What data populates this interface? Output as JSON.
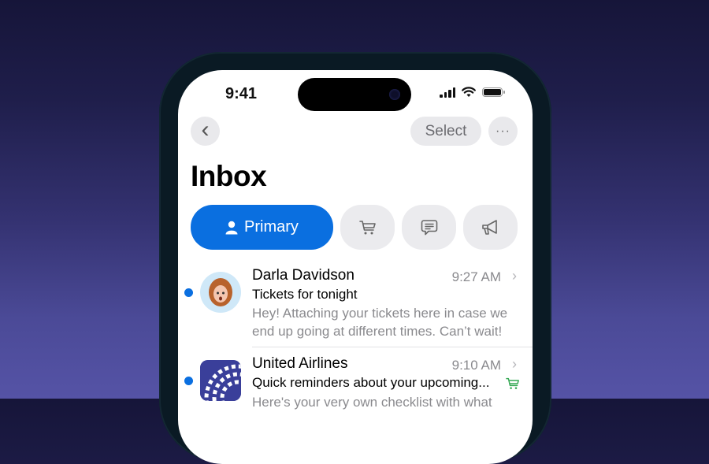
{
  "status_bar": {
    "time": "9:41",
    "icons": [
      "signal-icon",
      "wifi-icon",
      "battery-icon"
    ]
  },
  "nav": {
    "back_icon": "chevron-left-icon",
    "select_label": "Select",
    "more_icon": "ellipsis-icon",
    "more_glyph": "···",
    "back_glyph": "‹"
  },
  "header": {
    "title": "Inbox"
  },
  "categories": [
    {
      "label": "Primary",
      "icon": "person-icon",
      "active": true
    },
    {
      "label": "",
      "icon": "cart-icon",
      "active": false
    },
    {
      "label": "",
      "icon": "chat-icon",
      "active": false
    },
    {
      "label": "",
      "icon": "megaphone-icon",
      "active": false
    }
  ],
  "messages": [
    {
      "sender": "Darla Davidson",
      "time": "9:27 AM",
      "subject": "Tickets for tonight",
      "preview": "Hey! Attaching your tickets here in case we end up going at different times. Can’t wait!",
      "unread": true
    },
    {
      "sender": "United Airlines",
      "time": "9:10 AM",
      "subject": "Quick reminders about your upcoming...",
      "preview": "Here's your very own checklist with what",
      "unread": true,
      "category_icon": "cart-icon"
    }
  ],
  "colors": {
    "accent": "#0a6fe0",
    "shopping_green": "#34a853",
    "secondary_text": "#8a8a8e"
  },
  "chevron_glyph": "›"
}
